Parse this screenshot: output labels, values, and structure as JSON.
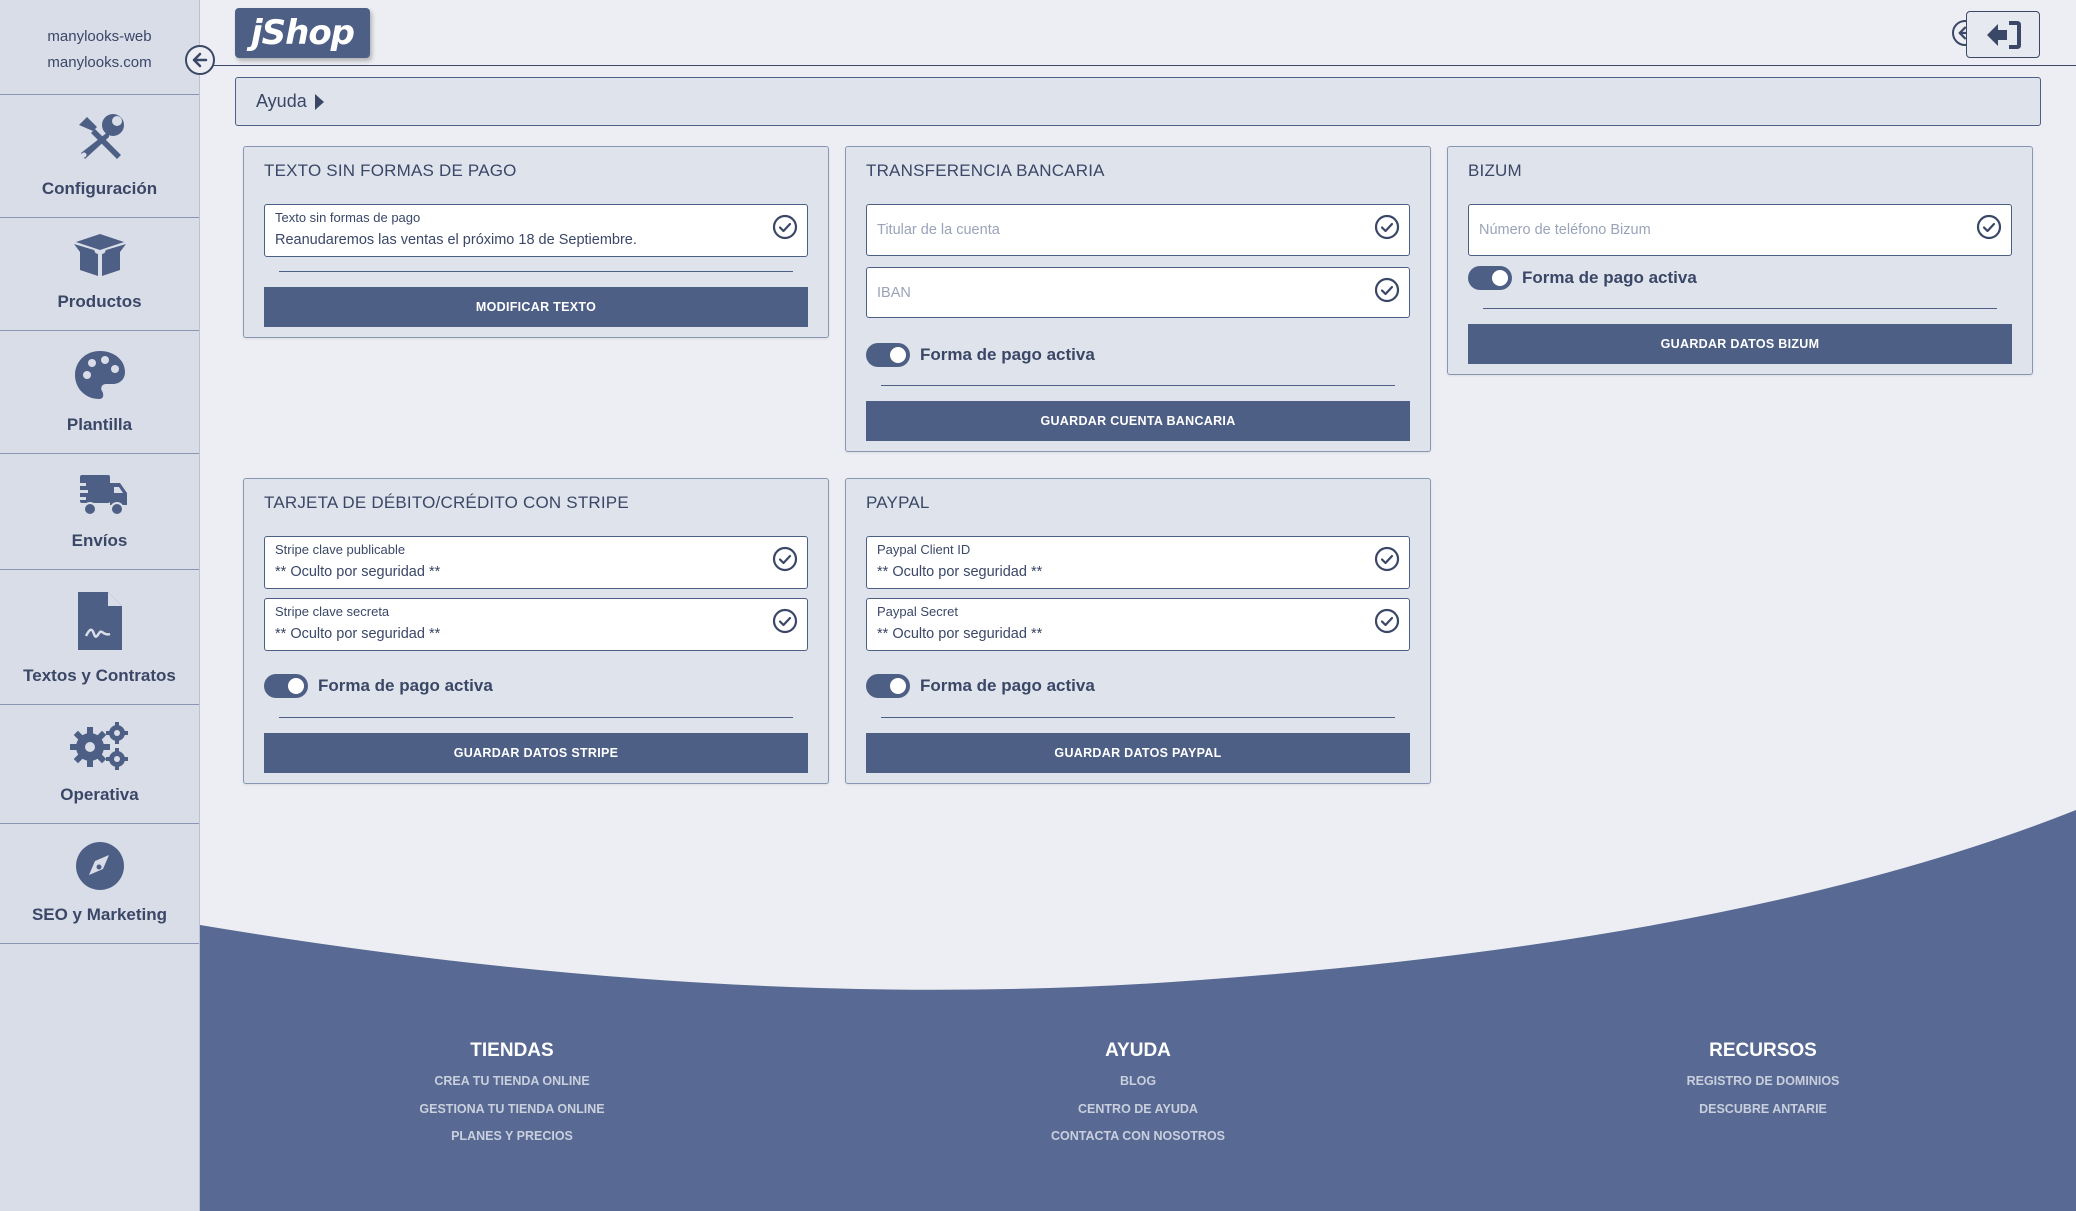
{
  "sidebar": {
    "account": "manylooks-web",
    "domain": "manylooks.com",
    "items": [
      {
        "label": "Configuración",
        "icon": "tools-icon"
      },
      {
        "label": "Productos",
        "icon": "box-icon"
      },
      {
        "label": "Plantilla",
        "icon": "palette-icon"
      },
      {
        "label": "Envíos",
        "icon": "truck-icon"
      },
      {
        "label": "Textos y Contratos",
        "icon": "contract-icon"
      },
      {
        "label": "Operativa",
        "icon": "gears-icon"
      },
      {
        "label": "SEO y Marketing",
        "icon": "compass-icon"
      }
    ]
  },
  "header": {
    "logo": "jShop",
    "help_label": "Ayuda"
  },
  "cards": {
    "no_payment": {
      "title": "TEXTO SIN FORMAS DE PAGO",
      "field_label": "Texto sin formas de pago",
      "field_value": "Reanudaremos las ventas el próximo 18 de Septiembre.",
      "button": "MODIFICAR TEXTO"
    },
    "bank": {
      "title": "TRANSFERENCIA BANCARIA",
      "holder_placeholder": "Titular de la cuenta",
      "iban_placeholder": "IBAN",
      "toggle_label": "Forma de pago activa",
      "button": "GUARDAR CUENTA BANCARIA"
    },
    "bizum": {
      "title": "BIZUM",
      "phone_placeholder": "Número de teléfono Bizum",
      "toggle_label": "Forma de pago activa",
      "button": "GUARDAR DATOS BIZUM"
    },
    "stripe": {
      "title": "TARJETA DE DÉBITO/CRÉDITO CON STRIPE",
      "public_label": "Stripe clave publicable",
      "public_value": "** Oculto por seguridad **",
      "secret_label": "Stripe clave secreta",
      "secret_value": "** Oculto por seguridad **",
      "toggle_label": "Forma de pago activa",
      "button": "GUARDAR DATOS STRIPE"
    },
    "paypal": {
      "title": "PAYPAL",
      "client_label": "Paypal Client ID",
      "client_value": "** Oculto por seguridad **",
      "secret_label": "Paypal Secret",
      "secret_value": "** Oculto por seguridad **",
      "toggle_label": "Forma de pago activa",
      "button": "GUARDAR DATOS PAYPAL"
    }
  },
  "footer": {
    "tiendas": {
      "title": "TIENDAS",
      "links": [
        "CREA TU TIENDA ONLINE",
        "GESTIONA TU TIENDA ONLINE",
        "PLANES Y PRECIOS"
      ]
    },
    "ayuda": {
      "title": "AYUDA",
      "links": [
        "BLOG",
        "CENTRO DE AYUDA",
        "CONTACTA CON NOSOTROS"
      ]
    },
    "recursos": {
      "title": "RECURSOS",
      "links": [
        "REGISTRO DE DOMINIOS",
        "DESCUBRE ANTARIE"
      ]
    }
  },
  "colors": {
    "primary": "#4e5f85",
    "text": "#3a4766",
    "background": "#eceef3",
    "sidebar": "#d8dde8"
  }
}
